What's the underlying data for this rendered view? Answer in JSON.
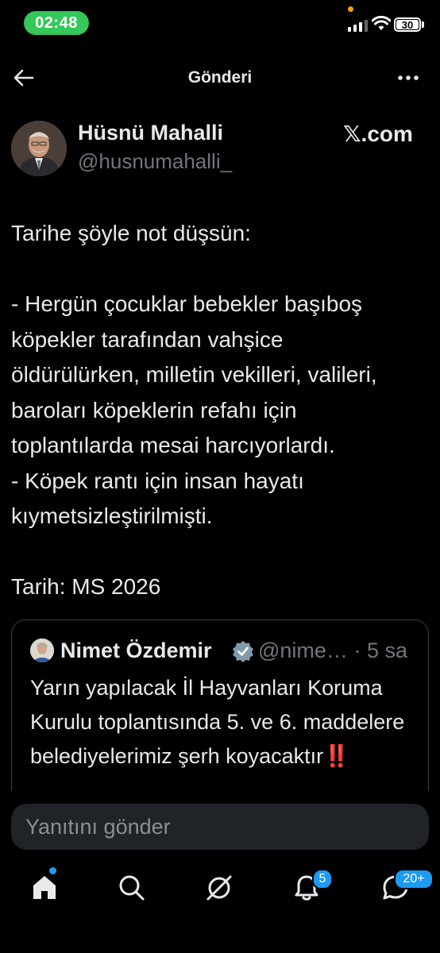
{
  "status_bar": {
    "time": "02:48",
    "battery": "30"
  },
  "header": {
    "title": "Gönderi"
  },
  "author": {
    "name": "Hüsnü Mahalli",
    "handle": "@husnumahalli_",
    "source": "𝕏.com"
  },
  "post": {
    "lines": [
      "Tarihe şöyle not düşsün:",
      "",
      "- Hergün çocuklar bebekler başıboş",
      "köpekler tarafından vahşice",
      "öldürülürken, milletin vekilleri, valileri,",
      "baroları köpeklerin refahı için",
      "toplantılarda mesai harcıyorlardı.",
      "- Köpek rantı için insan hayatı",
      "kıymetsizleştirilmişti.",
      "",
      "Tarih: MS 2026"
    ]
  },
  "quote": {
    "name": "Nimet Özdemir",
    "handle": "@nime…",
    "time": "· 5 sa",
    "text": "Yarın yapılacak İl Hayvanları Koruma Kurulu toplantısında 5. ve 6. maddelere belediyelerimiz şerh koyacaktır",
    "emoji": "‼️"
  },
  "reply": {
    "placeholder": "Yanıtını gönder"
  },
  "tabbar": {
    "notifications_badge": "5",
    "messages_badge": "20+"
  },
  "colors": {
    "accent": "#1d9bf0",
    "status_green": "#34c759",
    "background": "#000000"
  }
}
